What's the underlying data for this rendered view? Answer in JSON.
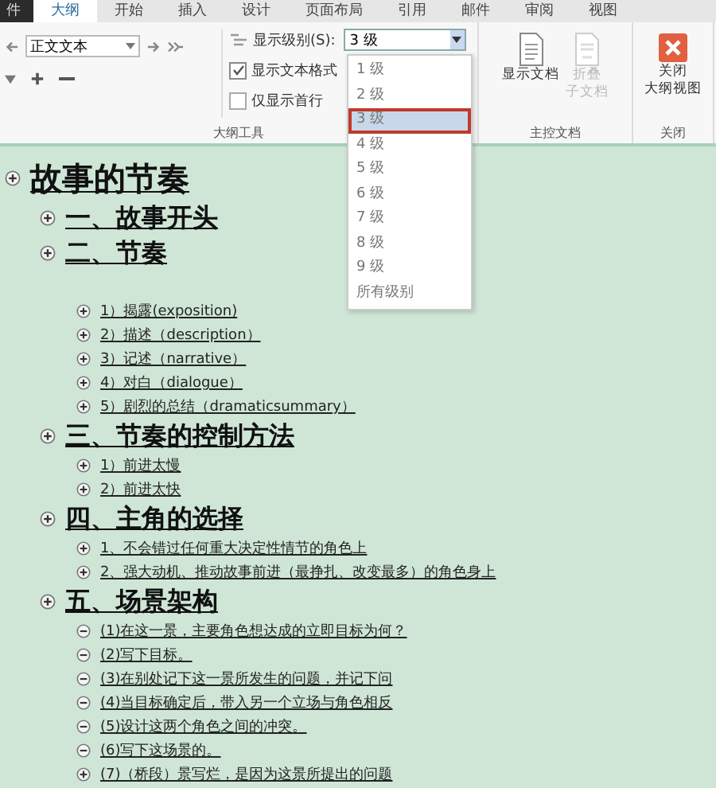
{
  "tabs": [
    {
      "label": "件",
      "kind": "file",
      "selected": false
    },
    {
      "label": "大纲",
      "kind": "tab",
      "selected": true
    },
    {
      "label": "开始",
      "kind": "tab",
      "selected": false
    },
    {
      "label": "插入",
      "kind": "tab",
      "selected": false
    },
    {
      "label": "设计",
      "kind": "tab",
      "selected": false
    },
    {
      "label": "页面布局",
      "kind": "tab",
      "selected": false
    },
    {
      "label": "引用",
      "kind": "tab",
      "selected": false
    },
    {
      "label": "邮件",
      "kind": "tab",
      "selected": false
    },
    {
      "label": "审阅",
      "kind": "tab",
      "selected": false
    },
    {
      "label": "视图",
      "kind": "tab",
      "selected": false
    }
  ],
  "ribbon": {
    "style_box": {
      "value": "正文文本"
    },
    "show_level": {
      "label": "显示级别(S):",
      "value": "3 级"
    },
    "checkboxes": [
      {
        "label": "显示文本格式",
        "checked": true
      },
      {
        "label": "仅显示首行",
        "checked": false
      }
    ],
    "master_buttons": [
      {
        "kind": "show",
        "lines": [
          "显示文档"
        ],
        "disabled": false
      },
      {
        "kind": "collapse",
        "lines": [
          "折叠",
          "子文档"
        ],
        "disabled": true
      }
    ],
    "close_button": {
      "lines": [
        "关闭",
        "大纲视图"
      ]
    },
    "groups": [
      "大纲工具",
      "主控文档",
      "关闭"
    ]
  },
  "level_dropdown": {
    "options": [
      {
        "label": "1 级",
        "selected": false
      },
      {
        "label": "2 级",
        "selected": false
      },
      {
        "label": "3 级",
        "selected": true
      },
      {
        "label": "4 级",
        "selected": false
      },
      {
        "label": "5 级",
        "selected": false
      },
      {
        "label": "6 级",
        "selected": false
      },
      {
        "label": "7 级",
        "selected": false
      },
      {
        "label": "8 级",
        "selected": false
      },
      {
        "label": "9 级",
        "selected": false
      },
      {
        "label": "所有级别",
        "selected": false
      }
    ]
  },
  "outline": [
    {
      "text": "故事的节奏",
      "has_children": true,
      "children": [
        {
          "text": "一、故事开头",
          "has_children": true
        },
        {
          "text": "二、节奏",
          "has_children": true,
          "children": [
            {
              "text": "1）揭露(exposition)",
              "has_children": true
            },
            {
              "text": "2）描述（description）",
              "has_children": true
            },
            {
              "text": "3）记述（narrative）",
              "has_children": true
            },
            {
              "text": "4）对白（dialogue）",
              "has_children": true
            },
            {
              "text": "5）剧烈的总结（dramaticsummary）",
              "has_children": true
            }
          ]
        },
        {
          "text": "三、节奏的控制方法",
          "has_children": true,
          "children": [
            {
              "text": "1）前进太慢",
              "has_children": true
            },
            {
              "text": "2）前进太快",
              "has_children": true
            }
          ]
        },
        {
          "text": "四、主角的选择",
          "has_children": true,
          "children": [
            {
              "text": "1、不会错过任何重大决定性情节的角色上",
              "has_children": true
            },
            {
              "text": "2、强大动机、推动故事前进（最挣扎、改变最多）的角色身上",
              "has_children": true
            }
          ]
        },
        {
          "text": "五、场景架构",
          "has_children": true,
          "children": [
            {
              "text": "(1)在这一景，主要角色想达成的立即目标为何？",
              "has_children": false
            },
            {
              "text": "(2)写下目标。",
              "has_children": false
            },
            {
              "text": "(3)在别处记下这一景所发生的问题，并记下问",
              "has_children": false
            },
            {
              "text": "(4)当目标确定后，带入另一个立场与角色相反",
              "has_children": false
            },
            {
              "text": "(5)设计这两个角色之间的冲突。",
              "has_children": false
            },
            {
              "text": "(6)写下这场景的。",
              "has_children": false
            },
            {
              "text": "(7)（桥段）景写烂，是因为这景所提出的问题",
              "has_children": true
            }
          ]
        }
      ]
    }
  ]
}
